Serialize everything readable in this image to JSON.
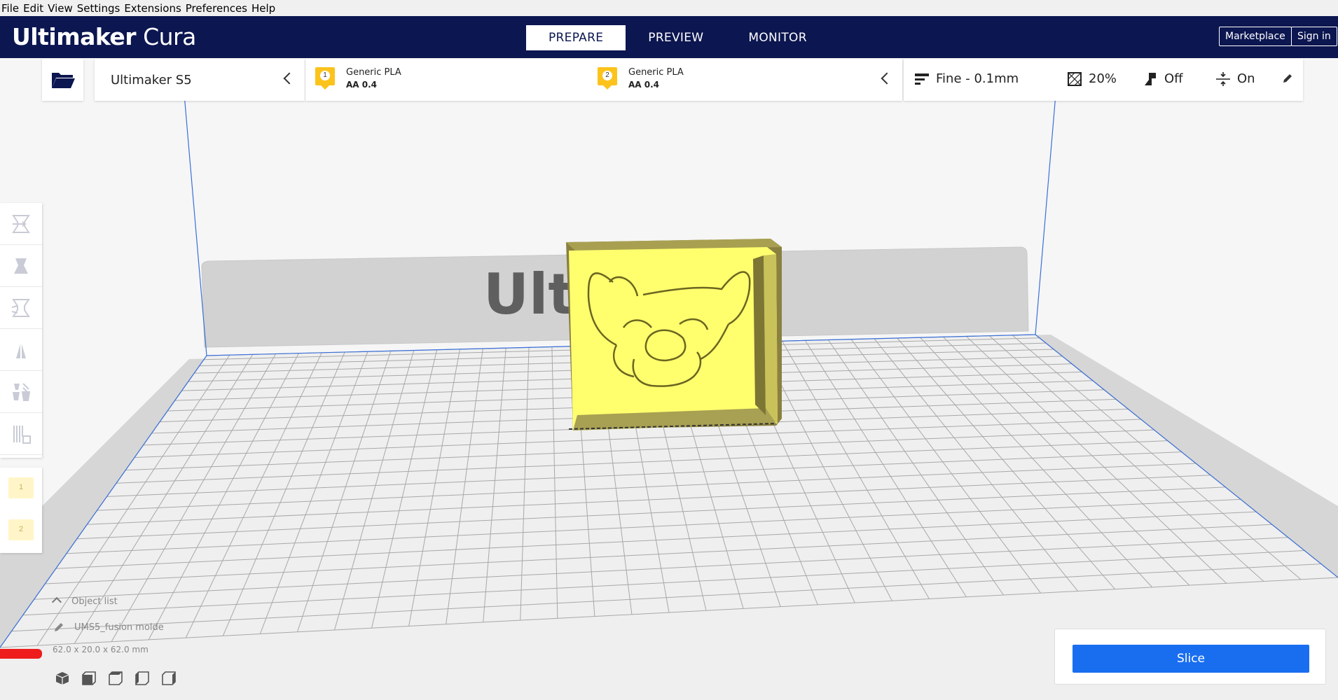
{
  "menu": {
    "file": "File",
    "edit": "Edit",
    "view": "View",
    "settings": "Settings",
    "extensions": "Extensions",
    "preferences": "Preferences",
    "help": "Help"
  },
  "header": {
    "logo_bold": "Ultimaker",
    "logo_light": "Cura",
    "stages": [
      "PREPARE",
      "PREVIEW",
      "MONITOR"
    ],
    "active_stage": "PREPARE",
    "marketplace": "Marketplace",
    "signin": "Sign in"
  },
  "printer": {
    "name": "Ultimaker S5"
  },
  "extruders": [
    {
      "index": "1",
      "material": "Generic PLA",
      "nozzle": "AA 0.4"
    },
    {
      "index": "2",
      "material": "Generic PLA",
      "nozzle": "AA 0.4"
    }
  ],
  "print_settings": {
    "profile": "Fine - 0.1mm",
    "infill": "20%",
    "support": "Off",
    "adhesion": "On"
  },
  "build_plate": {
    "logo_text": "Ult"
  },
  "extruder_selector": [
    "1",
    "2"
  ],
  "object": {
    "list_label": "Object list",
    "name": "UMS5_fusion molde",
    "dimensions": "62.0 x 20.0 x 62.0 mm"
  },
  "slice": {
    "label": "Slice"
  },
  "colors": {
    "header_bg": "#0c1650",
    "accent": "#196ef0",
    "model": "#ffff6e",
    "extruder_badge": "#fcc31c"
  }
}
